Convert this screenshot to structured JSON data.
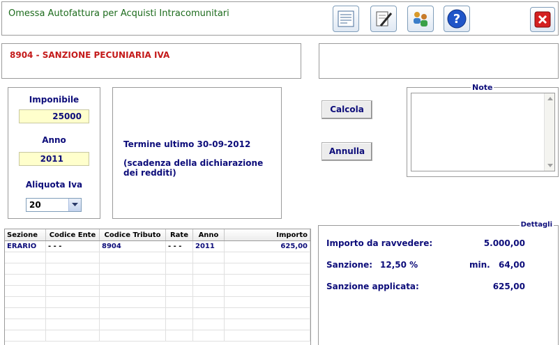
{
  "header": {
    "title": "Omessa Autofattura per Acquisti Intracomunitari"
  },
  "toolbar": {
    "icons": [
      "document-icon",
      "edit-icon",
      "users-icon",
      "help-icon",
      "close-icon"
    ]
  },
  "code_panel": {
    "code_label": "8904 - SANZIONE PECUNIARIA IVA"
  },
  "inputs": {
    "imponibile_label": "Imponibile",
    "imponibile_value": "25000",
    "anno_label": "Anno",
    "anno_value": "2011",
    "aliquota_label": "Aliquota Iva",
    "aliquota_value": "20"
  },
  "info": {
    "termine": "Termine ultimo 30-09-2012",
    "scadenza": "(scadenza della dichiarazione dei redditi)"
  },
  "buttons": {
    "calcola": "Calcola",
    "annulla": "Annulla"
  },
  "note": {
    "legend": "Note",
    "value": ""
  },
  "table": {
    "columns": [
      "Sezione",
      "Codice Ente",
      "Codice Tributo",
      "Rate",
      "Anno",
      "Importo"
    ],
    "rows": [
      [
        "ERARIO",
        "- - -",
        "8904",
        "- - -",
        "2011",
        "625,00"
      ]
    ]
  },
  "dettagli": {
    "legend": "Dettagli",
    "importo_label": "Importo da ravvedere:",
    "importo_value": "5.000,00",
    "sanzione_label": "Sanzione:",
    "sanzione_pct": "12,50 %",
    "sanzione_min_label": "min.",
    "sanzione_min_value": "64,00",
    "applicata_label": "Sanzione applicata:",
    "applicata_value": "625,00"
  },
  "colors": {
    "title_green": "#1c6b1c",
    "code_red": "#c41a1a",
    "navy": "#0d0d7a",
    "field_yellow": "#ffffcc"
  }
}
